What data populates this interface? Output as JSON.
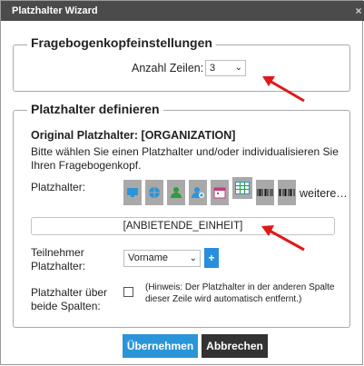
{
  "window": {
    "title": "Platzhalter Wizard",
    "close_glyph": "×"
  },
  "header_settings": {
    "legend": "Fragebogenkopfeinstellungen",
    "rows_label": "Anzahl Zeilen:",
    "rows_value": "3"
  },
  "placeholder_section": {
    "legend": "Platzhalter definieren",
    "original_label": "Original Platzhalter: [ORGANIZATION]",
    "instruction": "Bitte wählen Sie einen Platzhalter und/oder individualisieren Sie Ihren Fragebogenkopf.",
    "placeholder_label": "Platzhalter:",
    "icons": [
      "monitor-icon",
      "globe-icon",
      "person-icon",
      "person-add-icon",
      "calendar-icon",
      "spreadsheet-icon",
      "barcode-icon",
      "barcode-icon"
    ],
    "more_link": "weitere…",
    "field_value": "[ANBIETENDE_EINHEIT]",
    "participant_label": "Teilnehmer Platzhalter:",
    "participant_value": "Vorname",
    "add_glyph": "+",
    "both_columns_label": "Platzhalter über beide Spalten:",
    "hint": "(Hinweis: Der Platzhalter in der anderen Spalte dieser Zeile wird automatisch entfernt.)"
  },
  "buttons": {
    "apply": "Übernehmen",
    "cancel": "Abbrechen"
  },
  "colors": {
    "titlebar": "#4b4b4b",
    "accent_blue": "#2a95d8",
    "annotation_red": "#e01818",
    "icon_button_bg": "#a9a9a9"
  }
}
